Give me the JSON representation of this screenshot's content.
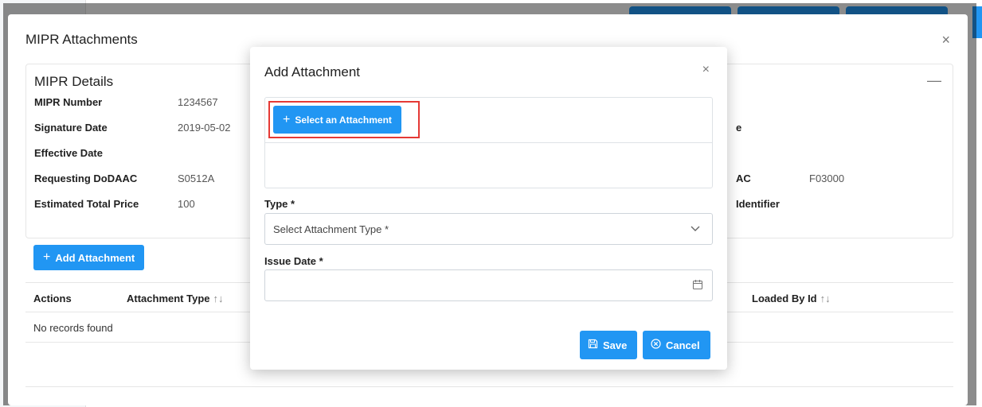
{
  "outer_dialog": {
    "title": "MIPR Attachments",
    "close_glyph": "×",
    "details": {
      "title": "MIPR Details",
      "collapse_glyph": "—",
      "rows": [
        {
          "label": "MIPR Number",
          "value": "1234567"
        },
        {
          "label": "Signature Date",
          "value": "2019-05-02"
        },
        {
          "label": "Effective Date",
          "value": ""
        },
        {
          "label": "Requesting DoDAAC",
          "value": "S0512A"
        },
        {
          "label": "Estimated Total Price",
          "value": "100"
        }
      ],
      "right_fragments": [
        {
          "label": "e",
          "value": ""
        },
        {
          "label": "AC",
          "value": "F03000"
        },
        {
          "label": "Identifier",
          "value": ""
        }
      ]
    },
    "add_attachment_label": "Add Attachment",
    "table": {
      "columns": [
        "Actions",
        "Attachment Type",
        "Loaded By Id"
      ],
      "empty_message": "No records found"
    }
  },
  "modal": {
    "title": "Add Attachment",
    "close_glyph": "×",
    "select_attachment_label": "Select an Attachment",
    "type_label": "Type *",
    "type_placeholder": "Select Attachment Type *",
    "issue_date_label": "Issue Date *",
    "issue_date_value": "",
    "save_label": "Save",
    "cancel_label": "Cancel"
  },
  "colors": {
    "accent": "#2196f3",
    "highlight": "#e53935",
    "overlay": "rgba(0,0,0,0.45)"
  }
}
